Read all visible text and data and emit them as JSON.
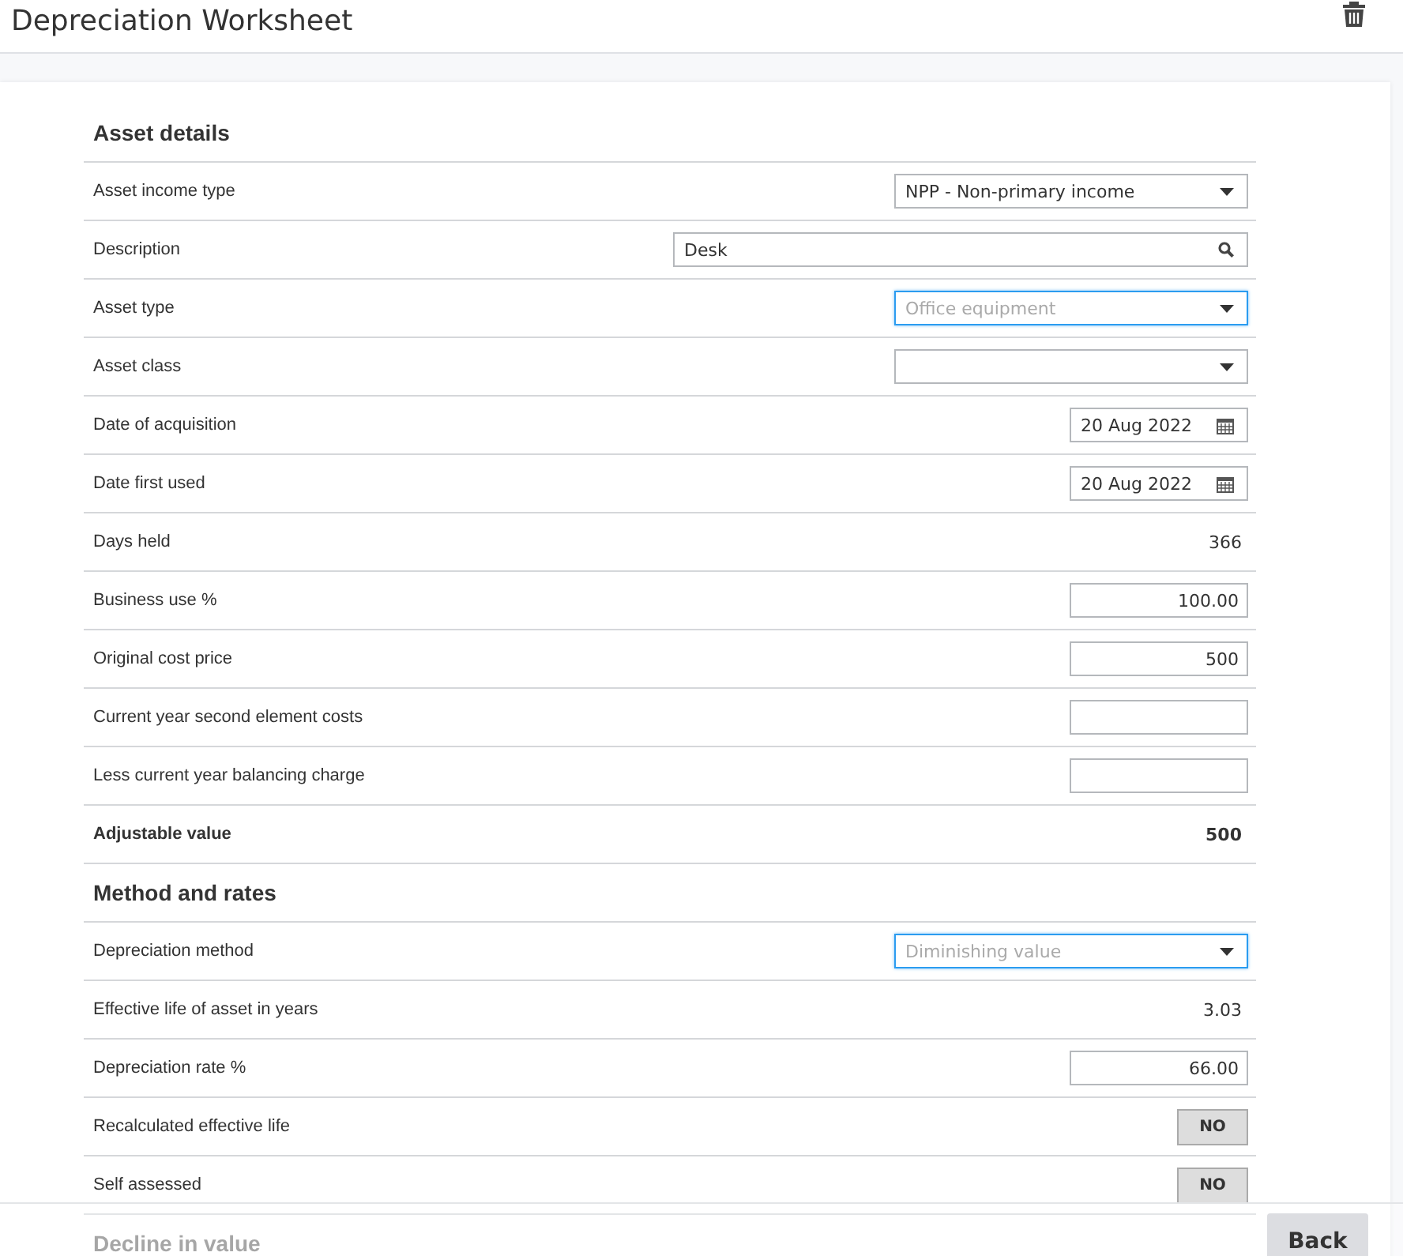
{
  "header": {
    "title": "Depreciation Worksheet"
  },
  "sections": [
    {
      "title": "Asset details",
      "rows": [
        {
          "label": "Asset income type",
          "kind": "select",
          "value": "NPP - Non-primary income",
          "focused": false
        },
        {
          "label": "Description",
          "kind": "search",
          "value": "Desk"
        },
        {
          "label": "Asset type",
          "kind": "select",
          "placeholder": "Office equipment",
          "focused": true
        },
        {
          "label": "Asset class",
          "kind": "select",
          "focused": false
        },
        {
          "label": "Date of acquisition",
          "kind": "date",
          "value": "20 Aug 2022"
        },
        {
          "label": "Date first used",
          "kind": "date",
          "value": "20 Aug 2022"
        },
        {
          "label": "Days held",
          "kind": "readout",
          "value": "366"
        },
        {
          "label": "Business use %",
          "kind": "number",
          "value": "100.00"
        },
        {
          "label": "Original cost price",
          "kind": "number",
          "value": "500"
        },
        {
          "label": "Current year second element costs",
          "kind": "number"
        },
        {
          "label": "Less current year balancing charge",
          "kind": "number"
        },
        {
          "label": "Adjustable value",
          "kind": "total",
          "value": "500"
        }
      ]
    },
    {
      "title": "Method and rates",
      "rows": [
        {
          "label": "Depreciation method",
          "kind": "select",
          "placeholder": "Diminishing value",
          "focused": true
        },
        {
          "label": "Effective life of asset in years",
          "kind": "readout",
          "value": "3.03"
        },
        {
          "label": "Depreciation rate %",
          "kind": "number",
          "value": "66.00"
        },
        {
          "label": "Recalculated effective life",
          "kind": "toggle",
          "value": "NO"
        },
        {
          "label": "Self assessed",
          "kind": "toggle",
          "value": "NO"
        }
      ]
    },
    {
      "title": "Decline in value"
    }
  ],
  "footer": {
    "back_button": "Back"
  }
}
